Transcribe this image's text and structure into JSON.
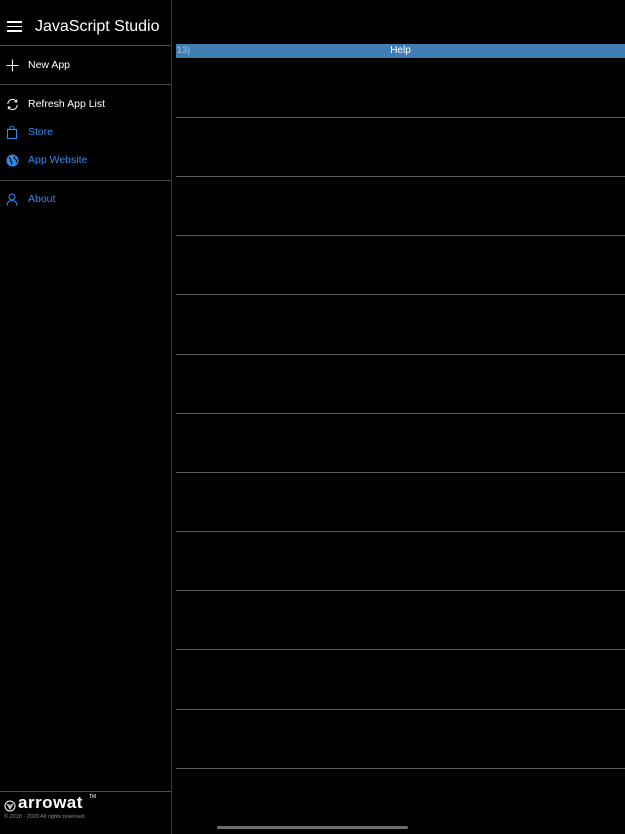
{
  "app": {
    "title": "JavaScript Studio"
  },
  "sidebar": {
    "items": [
      {
        "label": "New App",
        "icon": "plus-icon"
      },
      {
        "label": "Refresh App List",
        "icon": "refresh-icon"
      },
      {
        "label": "Store",
        "icon": "shopping-bag-icon"
      },
      {
        "label": "App Website",
        "icon": "globe-icon"
      },
      {
        "label": "About",
        "icon": "person-icon"
      }
    ],
    "footer": {
      "logo_text": "arrowat",
      "logo_tm": "TM",
      "copyright": "© 2018 - 2020 All rights reserved."
    }
  },
  "main": {
    "help_bar": {
      "left_text": "13)",
      "label": "Help"
    }
  },
  "colors": {
    "accent": "#2f8cf0",
    "help_bar": "#3f7fb4",
    "background": "#000000"
  }
}
